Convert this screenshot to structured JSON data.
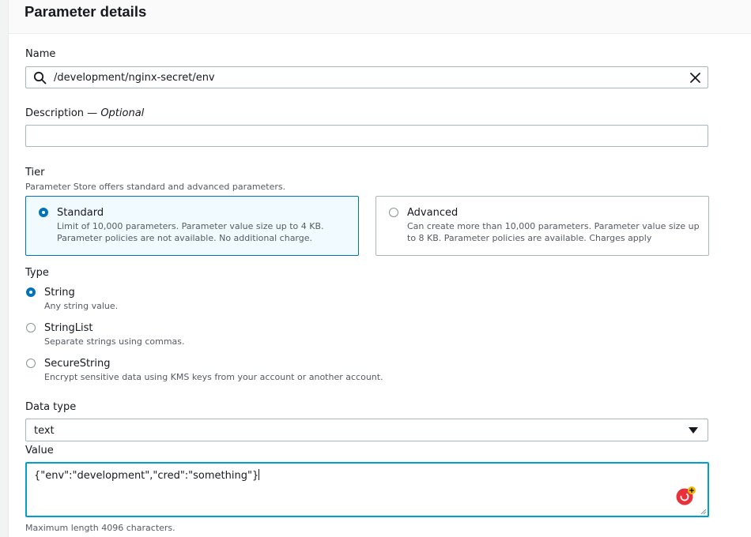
{
  "panel": {
    "title": "Parameter details"
  },
  "name": {
    "label": "Name",
    "value": "/development/nginx-secret/env"
  },
  "description": {
    "label": "Description — ",
    "optional_label": "Optional",
    "value": ""
  },
  "tier": {
    "label": "Tier",
    "hint": "Parameter Store offers standard and advanced parameters.",
    "options": [
      {
        "title": "Standard",
        "desc_line1": "Limit of 10,000 parameters. Parameter value size up to 4 KB.",
        "desc_line2": "Parameter policies are not available. No additional charge.",
        "selected": true
      },
      {
        "title": "Advanced",
        "desc_line1": "Can create more than 10,000 parameters. Parameter value size up",
        "desc_line2": "to 8 KB. Parameter policies are available. Charges apply",
        "selected": false
      }
    ]
  },
  "type": {
    "label": "Type",
    "options": [
      {
        "title": "String",
        "desc": "Any string value.",
        "selected": true
      },
      {
        "title": "StringList",
        "desc": "Separate strings using commas.",
        "selected": false
      },
      {
        "title": "SecureString",
        "desc": "Encrypt sensitive data using KMS keys from your account or another account.",
        "selected": false
      }
    ]
  },
  "data_type": {
    "label": "Data type",
    "value": "text"
  },
  "value": {
    "label": "Value",
    "text": "{\"env\":\"development\",\"cred\":\"something\"}",
    "hint": "Maximum length 4096 characters."
  },
  "colors": {
    "accent": "#0073bb",
    "focus": "#00a1c9",
    "selected_card_bg": "#f1faff",
    "grammarly": "#e8313b"
  },
  "icons": {
    "search": "search-icon",
    "clear": "close-icon",
    "dropdown": "caret-down-icon",
    "grammarly": "grammarly-icon"
  }
}
